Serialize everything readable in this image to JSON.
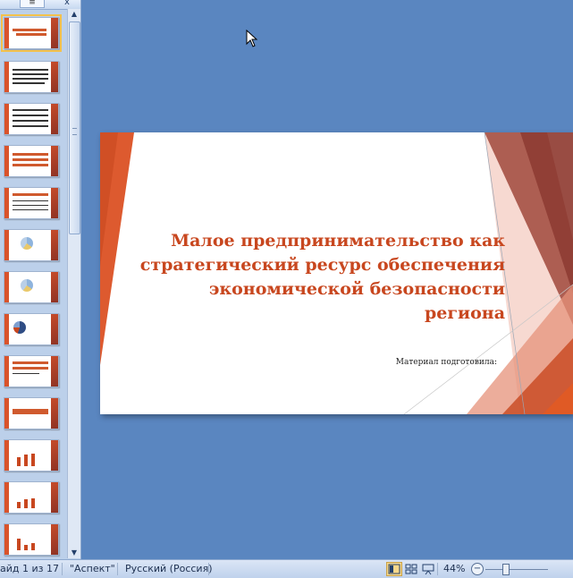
{
  "pane": {
    "outline_tab_icon": "list-icon",
    "close_label": "x"
  },
  "slide": {
    "title_lines": [
      "Малое предпринимательство  как",
      "стратегический  ресурс обеспечения",
      "экономической безопасности",
      "региона"
    ],
    "subtitle": "Материал подготовила:",
    "accent_color": "#c8471f"
  },
  "status": {
    "slide_counter": "айд 1 из 17",
    "theme": "\"Аспект\"",
    "language": "Русский (Россия)",
    "zoom": "44%",
    "zoom_minus": "−",
    "views": [
      "normal-view-icon",
      "slide-sorter-icon",
      "slideshow-icon"
    ]
  }
}
